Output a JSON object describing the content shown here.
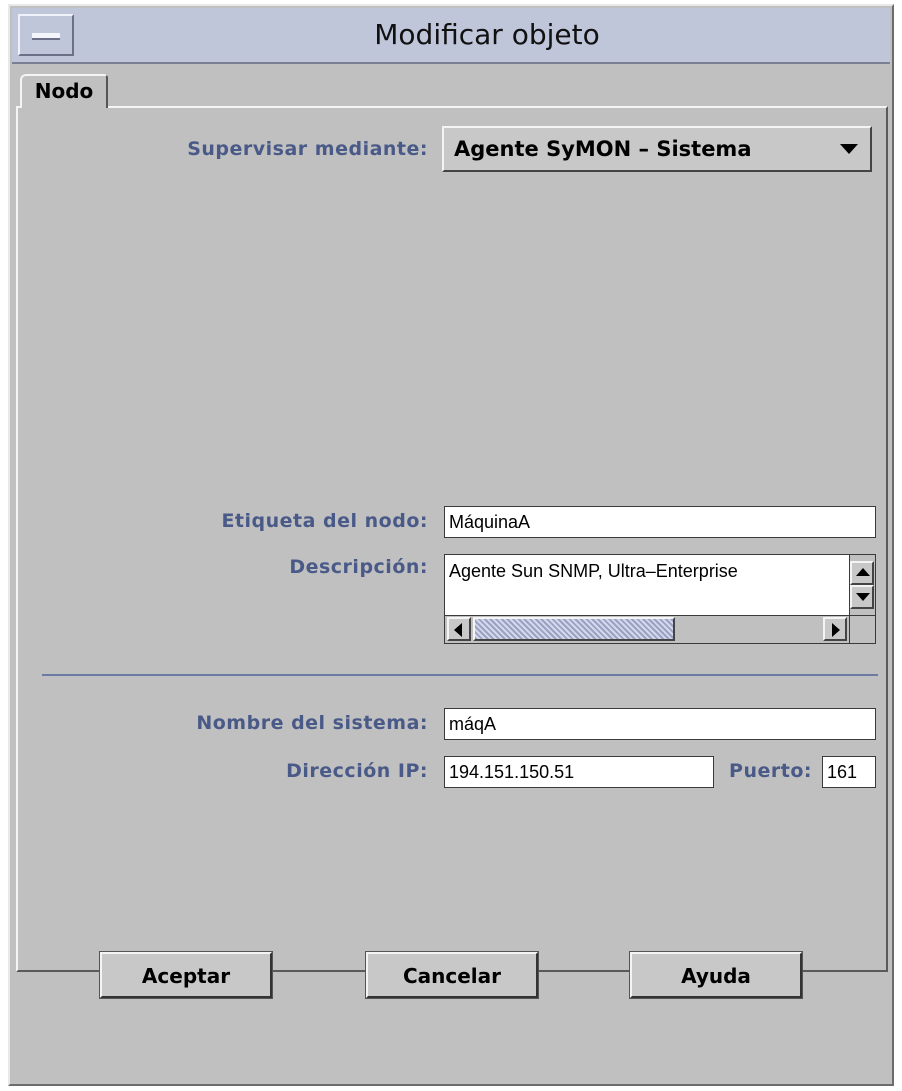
{
  "window": {
    "title": "Modificar objeto"
  },
  "tabs": [
    {
      "label": "Nodo",
      "active": true
    }
  ],
  "form": {
    "monitor": {
      "label": "Supervisar mediante:",
      "selected": "Agente SyMON – Sistema"
    },
    "node_label": {
      "label": "Etiqueta del nodo:",
      "value": "MáquinaA"
    },
    "description": {
      "label": "Descripción:",
      "value": "Agente Sun SNMP, Ultra–Enterprise"
    },
    "system_name": {
      "label": "Nombre del sistema:",
      "value": "máqA"
    },
    "ip_address": {
      "label": "Dirección IP:",
      "value": "194.151.150.51"
    },
    "port": {
      "label": "Puerto:",
      "value": "161"
    }
  },
  "buttons": {
    "accept": "Aceptar",
    "cancel": "Cancelar",
    "help": "Ayuda"
  },
  "colors": {
    "titlebar": "#bfc6da",
    "label_text": "#4a5a88",
    "background": "#c0c0c0"
  },
  "icons": {
    "window_menu": "window-menu-icon",
    "dropdown": "chevron-down-icon"
  }
}
